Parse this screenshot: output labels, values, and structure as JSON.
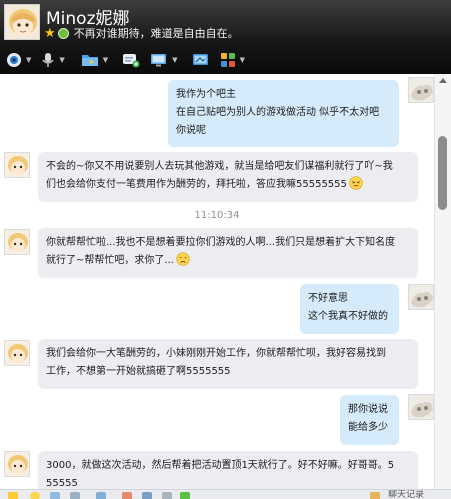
{
  "header": {
    "contact_name": "Minoz妮娜",
    "signature": "不再对谁期待，难道是自由自在。"
  },
  "toolbar": {
    "icons": [
      "webcam-icon",
      "microphone-icon",
      "folder-icon",
      "add-chat-icon",
      "screen-share-icon",
      "remote-assist-icon",
      "apps-icon"
    ]
  },
  "messages": [
    {
      "from": "me",
      "lines": [
        "我作为个吧主",
        "在自己贴吧为别人的游戏做活动   似乎不太对吧",
        "你说呢"
      ]
    },
    {
      "from": "contact",
      "lines": [
        "不会的~你又不用说要别人去玩其他游戏，就当是给吧友们谋福利就行了吖~我",
        "们也会给你支付一笔费用作为酬劳的，拜托啦，答应我嘛55555555"
      ]
    },
    {
      "from": "contact",
      "lines": [
        "你就帮帮忙啦...我也不是想着要拉你们游戏的人啊...我们只是想着扩大下知名度",
        "就行了~帮帮忙吧，求你了..."
      ]
    },
    {
      "from": "me",
      "lines": [
        "不好意思",
        "这个我真不好做的"
      ]
    },
    {
      "from": "contact",
      "lines": [
        "我们会给你一大笔酬劳的，小妹刚刚开始工作，你就帮帮忙呗，我好容易找到",
        "工作，不想第一开始就搞砸了啊5555555"
      ]
    },
    {
      "from": "me",
      "lines": [
        "那你说说",
        "能给多少"
      ]
    },
    {
      "from": "contact",
      "lines": [
        "3000，就做这次活动，然后帮着把活动置顶1天就行了。好不好嘛。好哥哥。5",
        "55555"
      ]
    }
  ],
  "timestamp": "11:10:34",
  "bottom": {
    "record_label": "聊天记录"
  },
  "colors": {
    "header_bg": "#141414",
    "incoming_bubble": "#ecedf0",
    "outgoing_bubble": "#d5ebfb",
    "status_online": "#6fbf3a"
  }
}
